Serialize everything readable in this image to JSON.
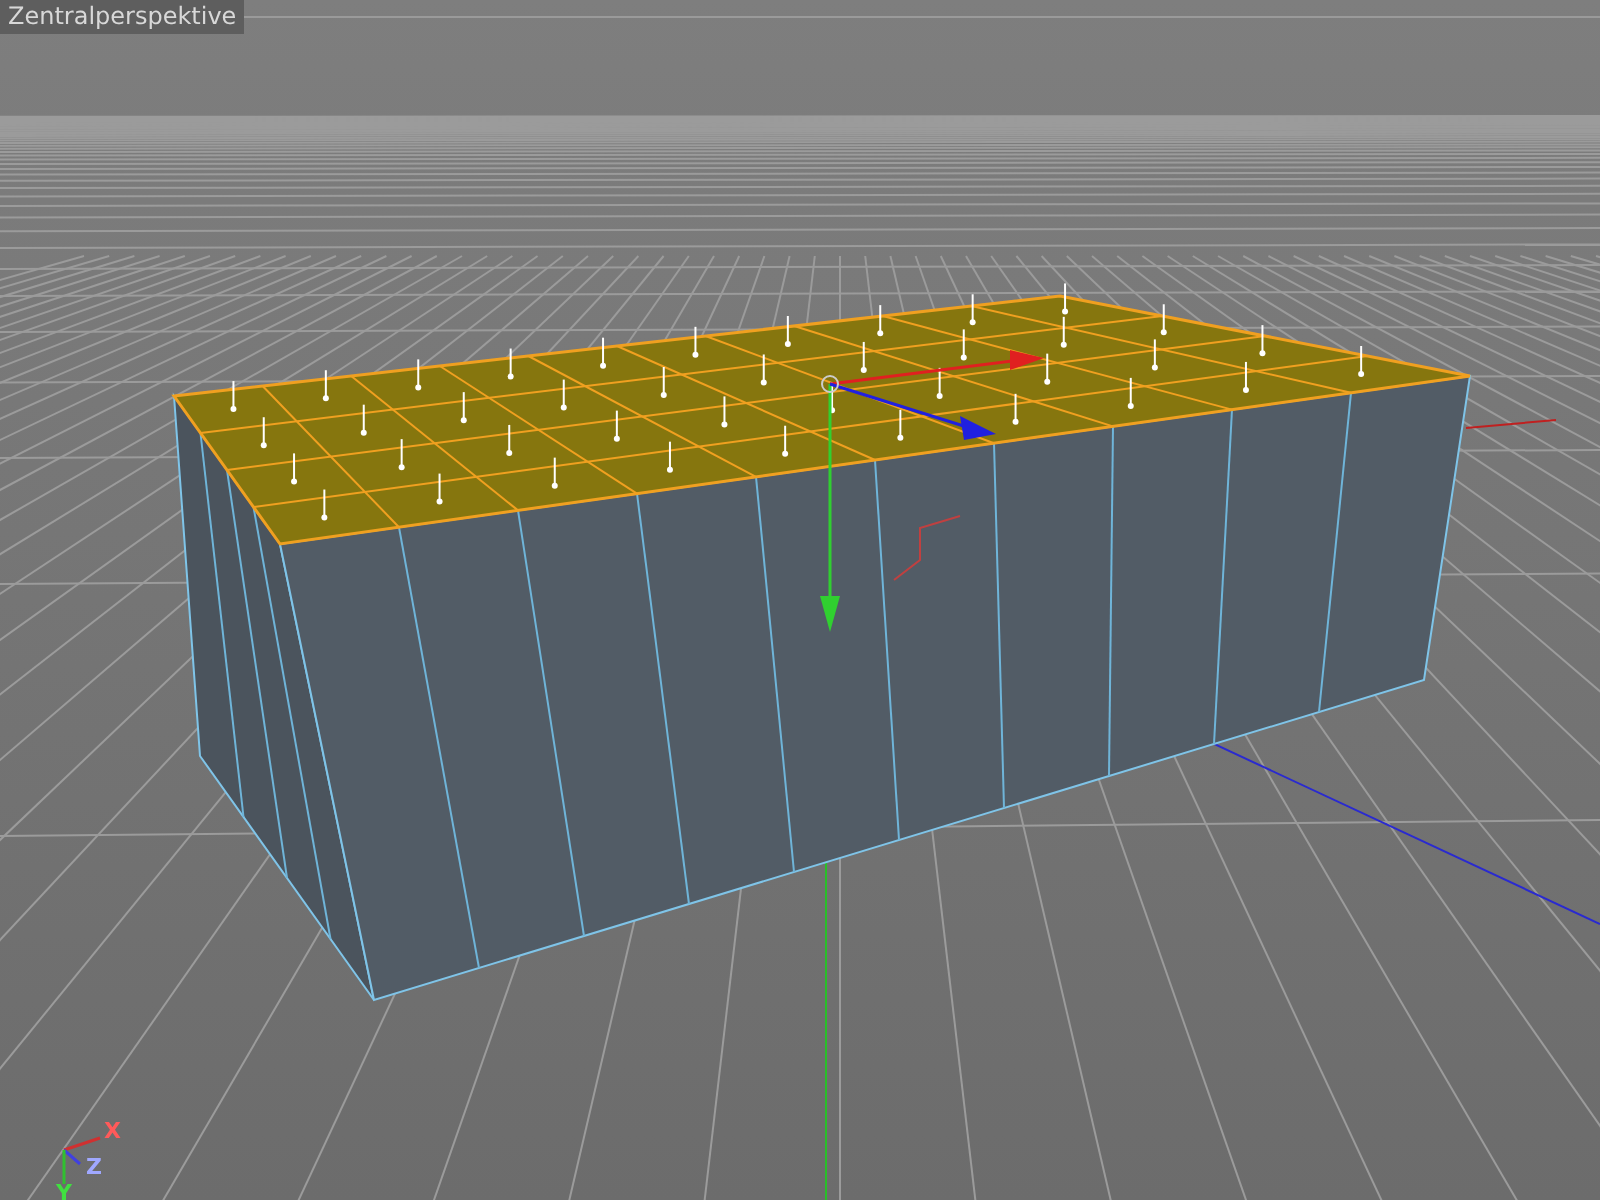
{
  "viewport": {
    "title": "Zentralperspektive",
    "axis_labels": [
      {
        "kind": "x",
        "text": "X"
      },
      {
        "kind": "z",
        "text": "Z"
      },
      {
        "kind": "y",
        "text": "Y"
      }
    ]
  }
}
